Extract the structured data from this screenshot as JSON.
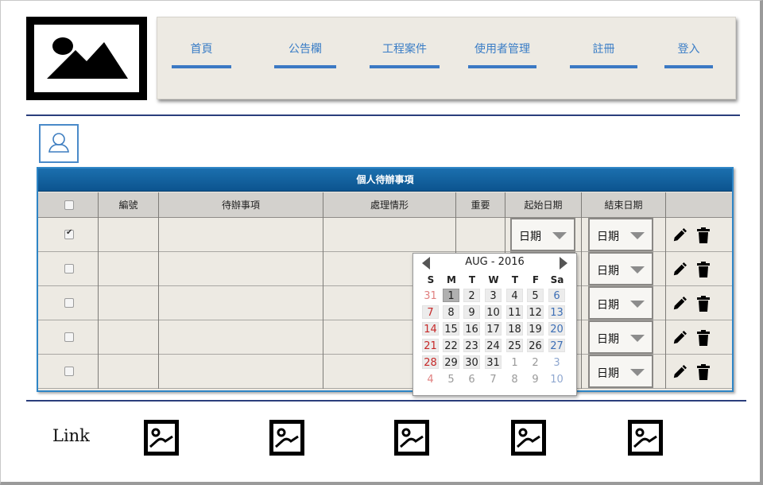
{
  "nav": {
    "items": [
      {
        "label": "首頁"
      },
      {
        "label": "公告欄"
      },
      {
        "label": "工程案件"
      },
      {
        "label": "使用者管理"
      },
      {
        "label": "註冊"
      },
      {
        "label": "登入"
      }
    ]
  },
  "table": {
    "title": "個人待辦事項",
    "headers": [
      "編號",
      "待辦事項",
      "處理情形",
      "重要",
      "起始日期",
      "結束日期"
    ],
    "date_placeholder": "日期",
    "rows": [
      {
        "checked": true
      },
      {
        "checked": false
      },
      {
        "checked": false
      },
      {
        "checked": false
      },
      {
        "checked": false
      }
    ]
  },
  "datepicker": {
    "title": "AUG - 2016",
    "weekdays": [
      "S",
      "M",
      "T",
      "W",
      "T",
      "F",
      "Sa"
    ],
    "weeks": [
      [
        "31",
        "1",
        "2",
        "3",
        "4",
        "5",
        "6"
      ],
      [
        "7",
        "8",
        "9",
        "10",
        "11",
        "12",
        "13"
      ],
      [
        "14",
        "15",
        "16",
        "17",
        "18",
        "19",
        "20"
      ],
      [
        "21",
        "22",
        "23",
        "24",
        "25",
        "26",
        "27"
      ],
      [
        "28",
        "29",
        "30",
        "31",
        "1",
        "2",
        "3"
      ],
      [
        "4",
        "5",
        "6",
        "7",
        "8",
        "9",
        "10"
      ]
    ],
    "selected": "1"
  },
  "footer": {
    "link_label": "Link"
  },
  "colors": {
    "nav_text": "#3a7dc6",
    "panel_header": "#0c548f",
    "divider": "#2b3e7c"
  }
}
